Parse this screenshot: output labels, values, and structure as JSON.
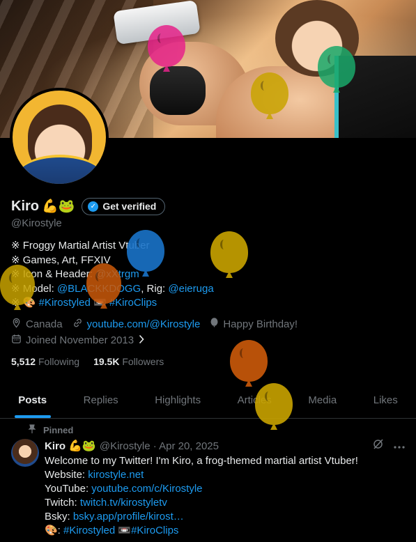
{
  "profile": {
    "name": "Kiro",
    "name_emojis": "💪🐸",
    "verify_button": "Get verified",
    "handle": "@Kirostyle",
    "bio": {
      "line1": "※ Froggy Martial Artist Vtuber",
      "line2": "※ Games, Art, FFXIV",
      "line3_prefix": "※ Icon & Header: ",
      "line3_link": "@xXtrgm",
      "line4_prefix": "※ Model: ",
      "line4_link1": "@BLACKKDOGG",
      "line4_mid": ", Rig: ",
      "line4_link2": "@eieruga",
      "line5_prefix": "※ 🎨 ",
      "line5_link1": "#Kirostyled",
      "line5_mid": " 📼 ",
      "line5_link2": "#KiroClips"
    },
    "location": "Canada",
    "website": "youtube.com/@Kirostyle",
    "birthday": "Happy Birthday!",
    "joined": "Joined November 2013",
    "following_count": "5,512",
    "following_label": "Following",
    "followers_count": "19.5K",
    "followers_label": "Followers"
  },
  "tabs": [
    {
      "label": "Posts",
      "active": true
    },
    {
      "label": "Replies",
      "active": false
    },
    {
      "label": "Highlights",
      "active": false
    },
    {
      "label": "Articles",
      "active": false
    },
    {
      "label": "Media",
      "active": false
    },
    {
      "label": "Likes",
      "active": false
    }
  ],
  "post": {
    "pinned_label": "Pinned",
    "author_name": "Kiro",
    "author_emojis": "💪🐸",
    "meta": "@Kirostyle · Apr 20, 2025",
    "line1": "Welcome to my Twitter! I'm Kiro, a frog-themed martial artist Vtuber!",
    "website_label": "Website: ",
    "website_link": "kirostyle.net",
    "youtube_label": "YouTube: ",
    "youtube_link": "youtube.com/c/Kirostyle",
    "twitch_label": "Twitch: ",
    "twitch_link": "twitch.tv/kirostyletv",
    "bsky_label": "Bsky: ",
    "bsky_link": "bsky.app/profile/kirost…",
    "tags_prefix": "🎨: ",
    "tags_link1": "#Kirostyled",
    "tags_mid": " 📼",
    "tags_link2": "#KiroClips"
  },
  "icons": {
    "location": "location-pin-icon",
    "link": "link-icon",
    "birthday": "balloon-icon",
    "calendar": "calendar-icon",
    "chevron": "chevron-right-icon",
    "verified": "verified-badge-icon",
    "pin": "pin-icon",
    "grok": "grok-icon",
    "more": "more-icon"
  },
  "colors": {
    "accent": "#1d9bf0",
    "muted": "#71767b",
    "background": "#000000",
    "balloon_blue": "#1a74c9",
    "balloon_yellow": "#c9a400",
    "balloon_orange": "#cc5a0a",
    "balloon_pink": "#e6238a",
    "balloon_green": "#1aa86a"
  }
}
